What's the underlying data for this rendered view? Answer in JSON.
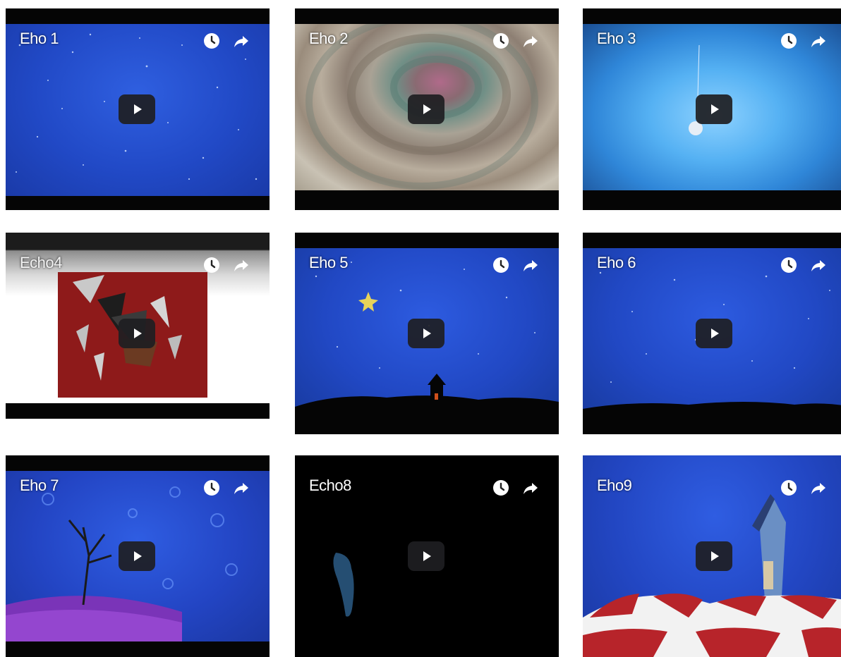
{
  "videos": [
    {
      "title": "Eho 1"
    },
    {
      "title": "Eho 2"
    },
    {
      "title": "Eho 3"
    },
    {
      "title": "Echo4"
    },
    {
      "title": "Eho 5"
    },
    {
      "title": "Eho 6"
    },
    {
      "title": "Eho 7"
    },
    {
      "title": "Echo8"
    },
    {
      "title": "Eho9"
    }
  ],
  "icons": {
    "watch_later": "clock-icon",
    "share": "share-arrow-icon",
    "play": "play-icon"
  },
  "colors": {
    "night_sky": "#1f49c8",
    "letterbox": "#050505",
    "play_button": "#1e1e22"
  }
}
